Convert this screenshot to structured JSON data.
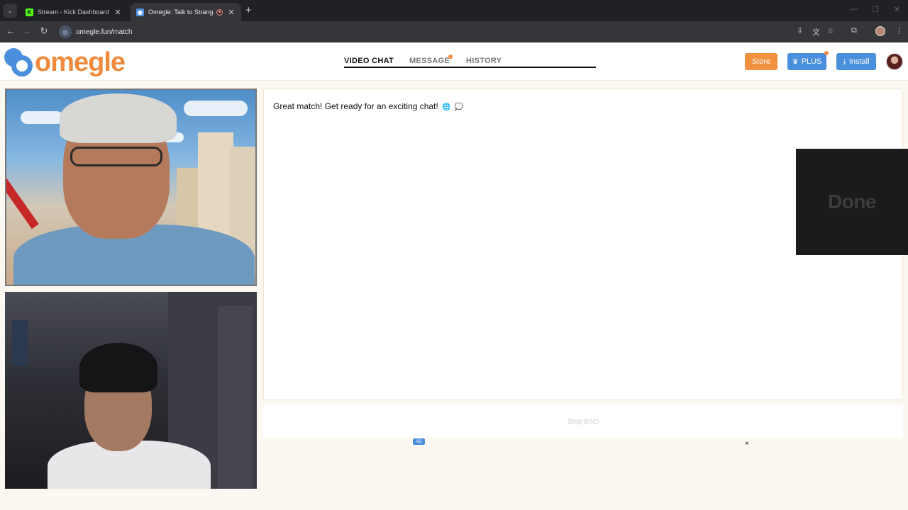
{
  "browser": {
    "tabs": [
      {
        "title": "Stream - Kick Dashboard",
        "active": false,
        "favicon": "kick-icon"
      },
      {
        "title": "Omegle: Talk to Strangers o",
        "active": true,
        "favicon": "omegle-icon",
        "recording": true
      }
    ],
    "url": "omegle.fun/match"
  },
  "header": {
    "logo_text": "omegle",
    "nav": {
      "video_chat": "VIDEO CHAT",
      "message": "MESSAGE",
      "history": "HISTORY"
    },
    "buttons": {
      "store": "Store",
      "plus": "PLUS",
      "install": "Install"
    }
  },
  "chat": {
    "message": "Great match! Get ready for an exciting chat!",
    "emojis": [
      "globe-icon",
      "speech-bubble-icon"
    ]
  },
  "overlay": {
    "done_label": "Done"
  },
  "stop_button": {
    "label": "Stop",
    "shortcut": "(ESC)"
  },
  "ad": {
    "badge": "AD",
    "close": "×"
  },
  "colors": {
    "brand_orange": "#f08a3c",
    "brand_blue": "#4a8fdc",
    "page_bg": "#fbf7f1"
  }
}
